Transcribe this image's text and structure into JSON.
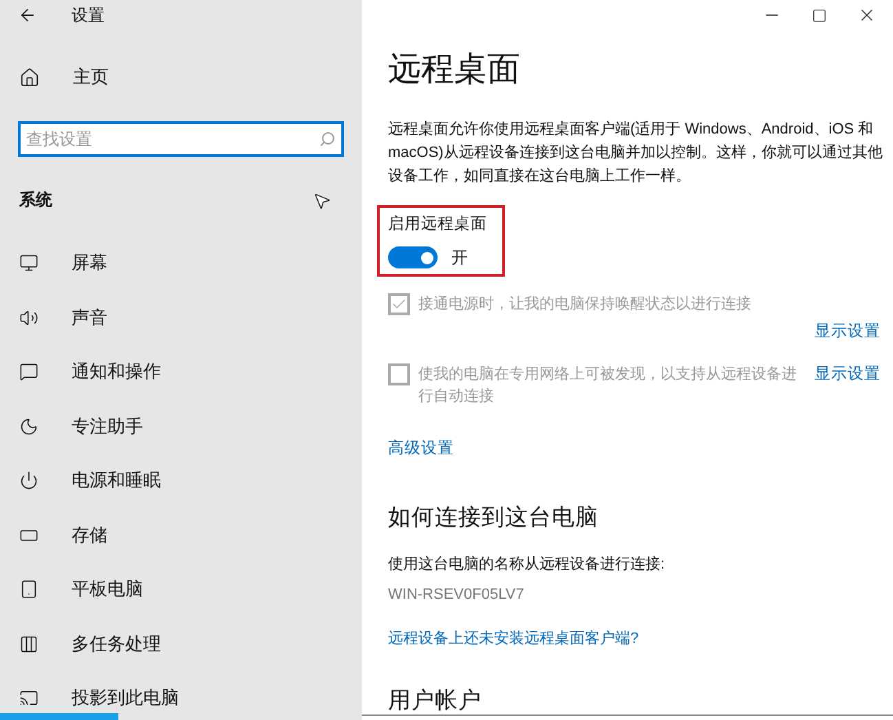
{
  "window": {
    "title": "设置"
  },
  "sidebar": {
    "home": "主页",
    "search": {
      "placeholder": "查找设置"
    },
    "section": "系统",
    "items": [
      {
        "label": "屏幕"
      },
      {
        "label": "声音"
      },
      {
        "label": "通知和操作"
      },
      {
        "label": "专注助手"
      },
      {
        "label": "电源和睡眠"
      },
      {
        "label": "存储"
      },
      {
        "label": "平板电脑"
      },
      {
        "label": "多任务处理"
      },
      {
        "label": "投影到此电脑"
      }
    ]
  },
  "content": {
    "title": "远程桌面",
    "description": "远程桌面允许你使用远程桌面客户端(适用于 Windows、Android、iOS 和 macOS)从远程设备连接到这台电脑并加以控制。这样，你就可以通过其他设备工作，如同直接在这台电脑上工作一样。",
    "toggle": {
      "label": "启用远程桌面",
      "on": true,
      "state_text": "开"
    },
    "options": [
      {
        "label": "接通电源时，让我的电脑保持唤醒状态以进行连接",
        "checked": true,
        "disabled": true,
        "link": "显示设置"
      },
      {
        "label": "使我的电脑在专用网络上可被发现，以支持从远程设备进行自动连接",
        "checked": false,
        "disabled": true,
        "link": "显示设置"
      }
    ],
    "advanced_link": "高级设置",
    "connect_heading": "如何连接到这台电脑",
    "connect_text": "使用这台电脑的名称从远程设备进行连接:",
    "pc_name": "WIN-RSEV0F05LV7",
    "client_link": "远程设备上还未安装远程桌面客户端?",
    "accounts_heading": "用户帐户"
  }
}
